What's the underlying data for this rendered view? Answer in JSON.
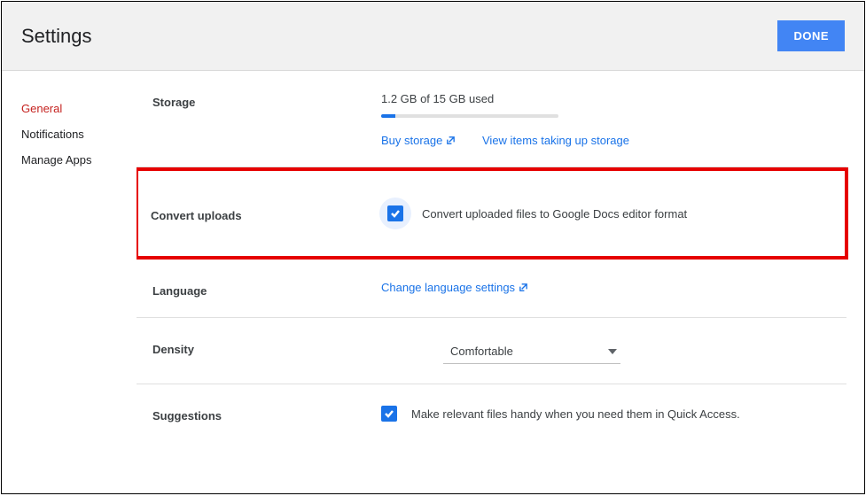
{
  "header": {
    "title": "Settings",
    "done": "DONE"
  },
  "sidebar": {
    "items": [
      {
        "label": "General",
        "active": true
      },
      {
        "label": "Notifications",
        "active": false
      },
      {
        "label": "Manage Apps",
        "active": false
      }
    ]
  },
  "storage": {
    "label": "Storage",
    "usage": "1.2 GB of 15 GB used",
    "buy": "Buy storage",
    "view": "View items taking up storage",
    "percent": 8
  },
  "convert": {
    "label": "Convert uploads",
    "checkbox_label": "Convert uploaded files to Google Docs editor format",
    "checked": true
  },
  "language": {
    "label": "Language",
    "link": "Change language settings"
  },
  "density": {
    "label": "Density",
    "value": "Comfortable"
  },
  "suggestions": {
    "label": "Suggestions",
    "checkbox_label": "Make relevant files handy when you need them in Quick Access.",
    "checked": true
  }
}
